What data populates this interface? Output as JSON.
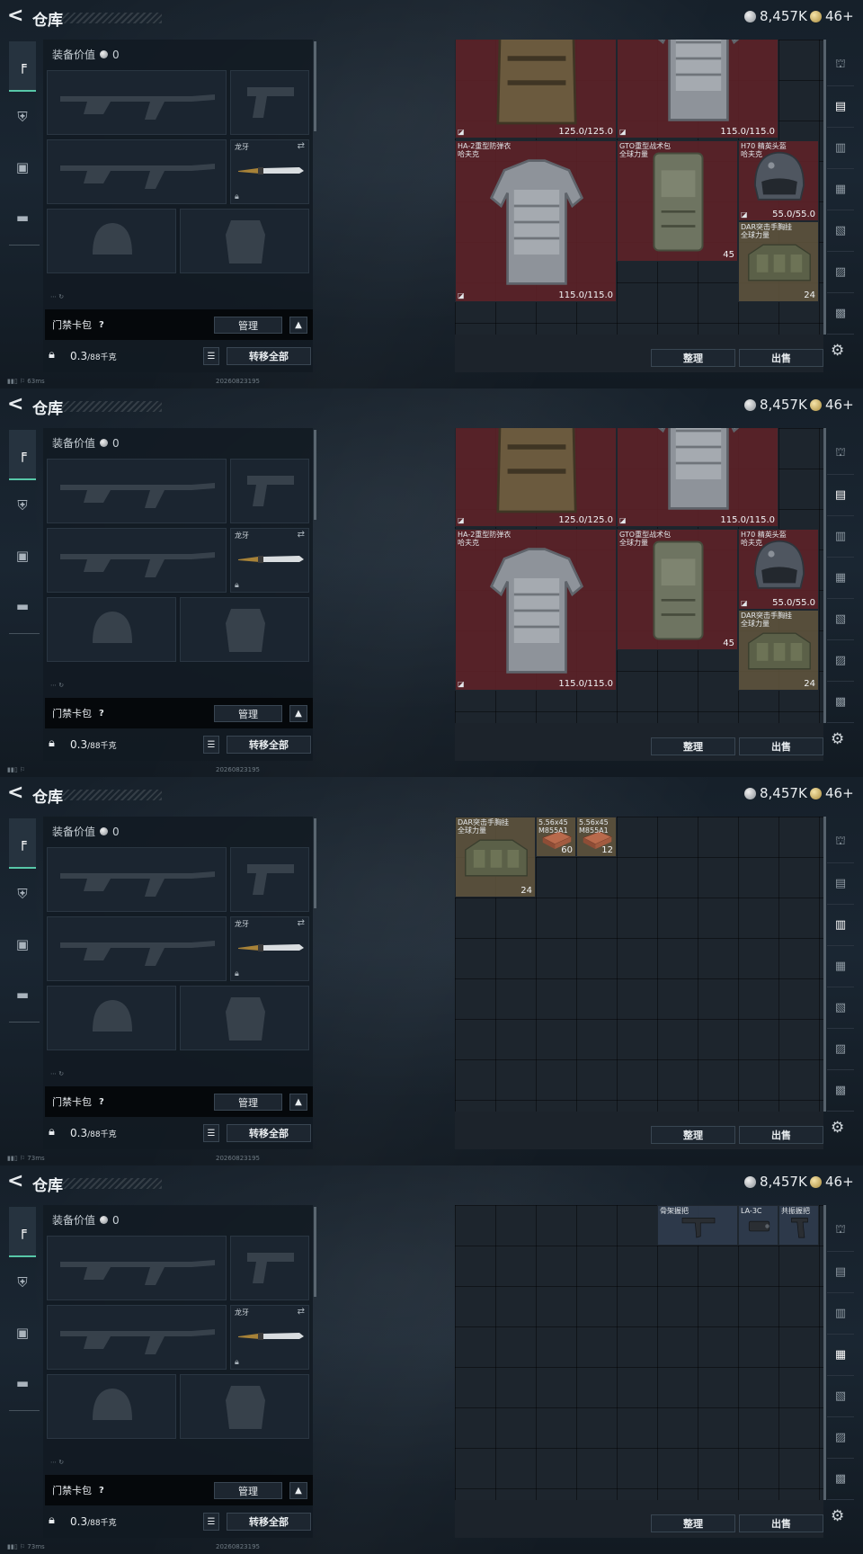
{
  "panels": [
    {
      "header": {
        "title": "仓库",
        "currency_silver": "8,457K",
        "currency_gold": "46+"
      },
      "loadout": {
        "eq_value_label": "装备价值",
        "eq_value": "0",
        "knife_name": "龙牙",
        "keycard_label": "门禁卡包",
        "manage_label": "管理",
        "weight_main": "0.3",
        "weight_max": "/88千克",
        "transfer_label": "转移全部",
        "status_ping": "63ms",
        "status_date": "20260823195"
      },
      "stash": {
        "sort_label": "整理",
        "sell_label": "出售",
        "active_right_tab": 1,
        "items": [
          {
            "kind": "vest_top",
            "name": "",
            "dura": "125.0/125.0",
            "style": "red"
          },
          {
            "kind": "armor_top",
            "name": "",
            "dura": "115.0/115.0",
            "style": "red"
          },
          {
            "kind": "armor",
            "name": "HA-2重型防弹衣\n哈夫克",
            "dura": "115.0/115.0",
            "style": "red"
          },
          {
            "kind": "backpack",
            "name": "GTO重型战术包\n全球力量",
            "count": "45",
            "style": "red"
          },
          {
            "kind": "helmet",
            "name": "H70 精英头盔\n哈夫克",
            "dura": "55.0/55.0",
            "style": "red"
          },
          {
            "kind": "chestrig",
            "name": "DAR突击手胸挂\n全球力量",
            "count": "24",
            "style": "khaki"
          }
        ]
      }
    },
    {
      "header": {
        "title": "仓库",
        "currency_silver": "8,457K",
        "currency_gold": "46+"
      },
      "loadout": {
        "eq_value_label": "装备价值",
        "eq_value": "0",
        "knife_name": "龙牙",
        "keycard_label": "门禁卡包",
        "manage_label": "管理",
        "weight_main": "0.3",
        "weight_max": "/88千克",
        "transfer_label": "转移全部",
        "status_ping": "",
        "status_date": "20260823195"
      },
      "stash": {
        "sort_label": "整理",
        "sell_label": "出售",
        "active_right_tab": 1,
        "items": [
          {
            "kind": "vest_top",
            "name": "",
            "dura": "125.0/125.0",
            "style": "red"
          },
          {
            "kind": "armor_top",
            "name": "",
            "dura": "115.0/115.0",
            "style": "red"
          },
          {
            "kind": "armor",
            "name": "HA-2重型防弹衣\n哈夫克",
            "dura": "115.0/115.0",
            "style": "red"
          },
          {
            "kind": "backpack",
            "name": "GTO重型战术包\n全球力量",
            "count": "45",
            "style": "red"
          },
          {
            "kind": "helmet",
            "name": "H70 精英头盔\n哈夫克",
            "dura": "55.0/55.0",
            "style": "red"
          },
          {
            "kind": "chestrig",
            "name": "DAR突击手胸挂\n全球力量",
            "count": "24",
            "style": "khaki"
          }
        ]
      }
    },
    {
      "header": {
        "title": "仓库",
        "currency_silver": "8,457K",
        "currency_gold": "46+"
      },
      "loadout": {
        "eq_value_label": "装备价值",
        "eq_value": "0",
        "knife_name": "龙牙",
        "keycard_label": "门禁卡包",
        "manage_label": "管理",
        "weight_main": "0.3",
        "weight_max": "/88千克",
        "transfer_label": "转移全部",
        "status_ping": "73ms",
        "status_date": "20260823195"
      },
      "stash": {
        "sort_label": "整理",
        "sell_label": "出售",
        "active_right_tab": 2,
        "items": [
          {
            "kind": "chestrig",
            "name": "DAR突击手胸挂\n全球力量",
            "count": "24",
            "style": "khaki"
          },
          {
            "kind": "ammo",
            "name": "5.56x45\nM855A1",
            "count": "60",
            "style": "khaki"
          },
          {
            "kind": "ammo",
            "name": "5.56x45\nM855A1",
            "count": "12",
            "style": "khaki"
          }
        ]
      }
    },
    {
      "header": {
        "title": "仓库",
        "currency_silver": "8,457K",
        "currency_gold": "46+"
      },
      "loadout": {
        "eq_value_label": "装备价值",
        "eq_value": "0",
        "knife_name": "龙牙",
        "keycard_label": "门禁卡包",
        "manage_label": "管理",
        "weight_main": "0.3",
        "weight_max": "/88千克",
        "transfer_label": "转移全部",
        "status_ping": "73ms",
        "status_date": "20260823195"
      },
      "stash": {
        "sort_label": "整理",
        "sell_label": "出售",
        "active_right_tab": 3,
        "items": [
          {
            "kind": "stock",
            "name": "骨架握把",
            "style": "blue"
          },
          {
            "kind": "laser",
            "name": "LA-3C",
            "style": "blue"
          },
          {
            "kind": "grip",
            "name": "共振握把",
            "style": "blue"
          }
        ]
      }
    }
  ]
}
